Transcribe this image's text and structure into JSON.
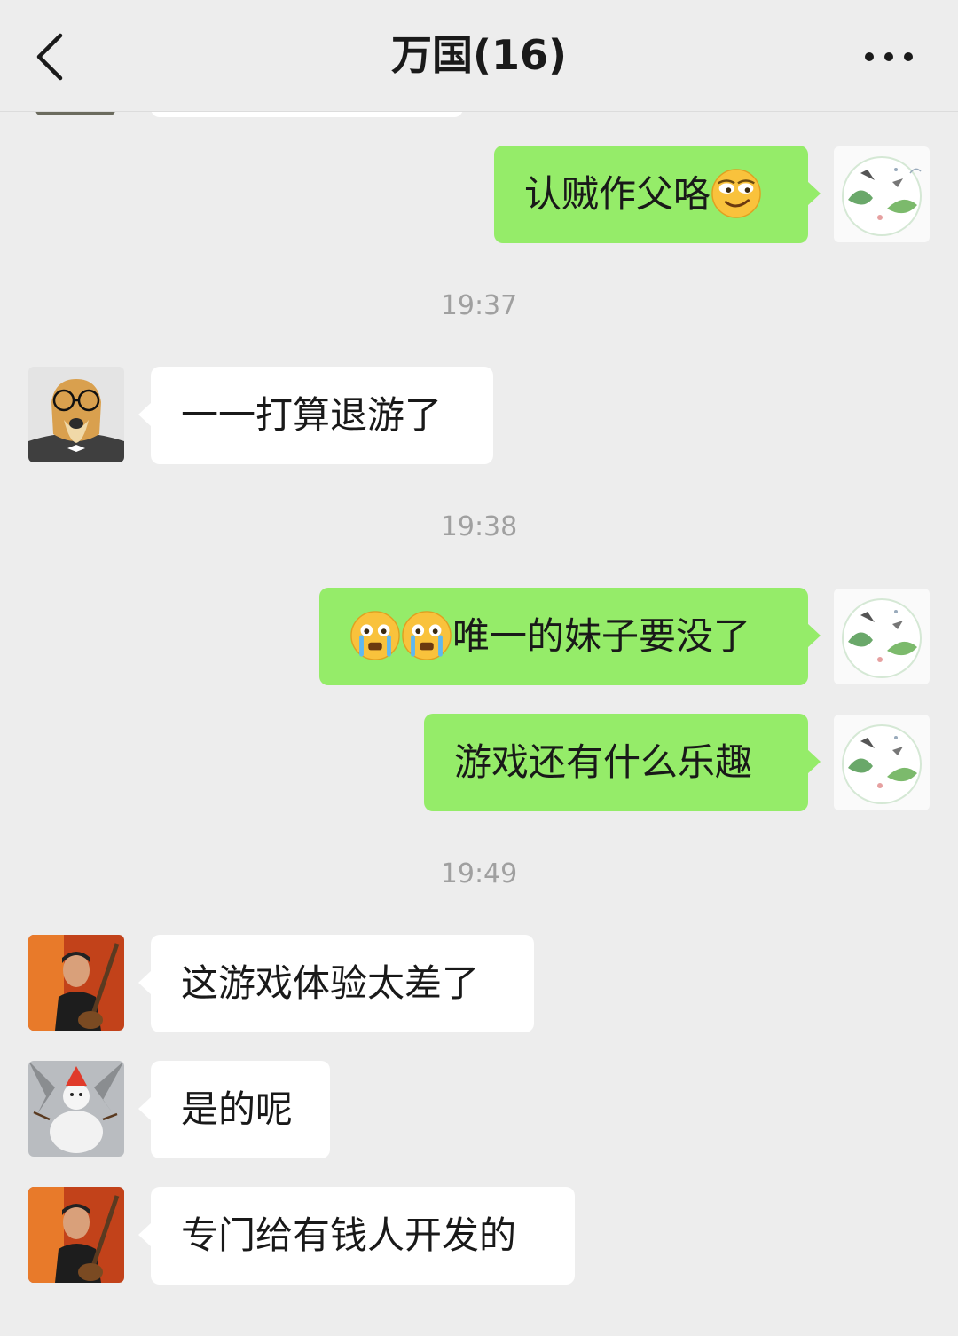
{
  "header": {
    "title": "万国(16)"
  },
  "messages": [
    {
      "text": "认贼作父咯",
      "emoji_after": "smirk-emoji"
    },
    {
      "time": "19:37"
    },
    {
      "text": "一一打算退游了"
    },
    {
      "time": "19:38"
    },
    {
      "text": "唯一的妹子要没了",
      "emoji_before": [
        "crying-emoji",
        "crying-emoji"
      ]
    },
    {
      "text": "游戏还有什么乐趣"
    },
    {
      "time": "19:49"
    },
    {
      "text": "这游戏体验太差了"
    },
    {
      "text": "是的呢"
    },
    {
      "text": "专门给有钱人开发的"
    }
  ],
  "colors": {
    "background": "#ededed",
    "self_bubble": "#95ec69",
    "other_bubble": "#ffffff",
    "timestamp": "#a0a0a0"
  }
}
